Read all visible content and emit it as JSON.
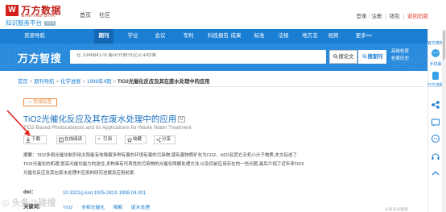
{
  "header": {
    "logo_mark": "W",
    "logo_cn": "万方数据",
    "logo_en": "WANFANG DATA",
    "logo_sub": "知识服务平台",
    "logo_tag": "V2.0",
    "links": {
      "home": "首页",
      "community": "社区"
    },
    "right": {
      "login": "登录",
      "sep": "/",
      "register": "注册",
      "wallet": "钱包",
      "old_version": "返回旧版"
    }
  },
  "nav": {
    "items": [
      "资源导航",
      "期刊",
      "学位",
      "会议",
      "专利",
      "科技报告",
      "成果",
      "标准",
      "法规",
      "地方志",
      "视频",
      "更多>>"
    ]
  },
  "hero": {
    "title": "万方智搜",
    "search_placeholder": "在 134684178 篇中外期刊论文中检索",
    "btn_search_all": "搜论文",
    "btn_search_journal": "搜期刊",
    "advanced": "高级检索",
    "history": "检索历史"
  },
  "sidebar": {
    "official_wechat": "官方微博",
    "mobile": "手机版",
    "wanfang_app": "万方选题"
  },
  "breadcrumb": {
    "items": [
      "首页",
      "期刊导航",
      "化学进展",
      "1998年4期"
    ],
    "current": "TiO2光催化反应及其在废水处理中的应用"
  },
  "article": {
    "add_tag": "+ 添加标签",
    "title_cn": "TiO2光催化反应及其在废水处理中的应用",
    "title_badge": "M",
    "title_en": "TiO2-Based Photocatalysis and Its Applications for Waste Water Treatment",
    "actions": [
      "下载",
      "在线阅读",
      "引用",
      "收藏",
      "分享"
    ],
    "abstract_label": "摘要：",
    "abstract_lines": [
      "TiO2多相光催化制剂用太阳能有效降解多种有害的环境有害的污染物,使有害物质矿化为CO2、H2O及其它无机小分子物质,本文综述了",
      "TiO2光催化的机理,提高光催化能力的途径,多种具有代表性的污染物的光催化降解处理方法,以及目前应用存在的一些问题,最后介绍了近年来TiO2",
      "光催化反应及其在废水处理中应用的研究进展及应用前景."
    ],
    "doi_label": "doi：",
    "doi_value": "10.3321/j.issn:1005-281X.1998.04.001",
    "keywords_label": "关键词：",
    "keywords": [
      "TiO2",
      "多相光催化",
      "降解",
      "废水处理"
    ]
  },
  "watermark": "◎ 头条@碰撞",
  "footer_right": "头条号@碰撞"
}
